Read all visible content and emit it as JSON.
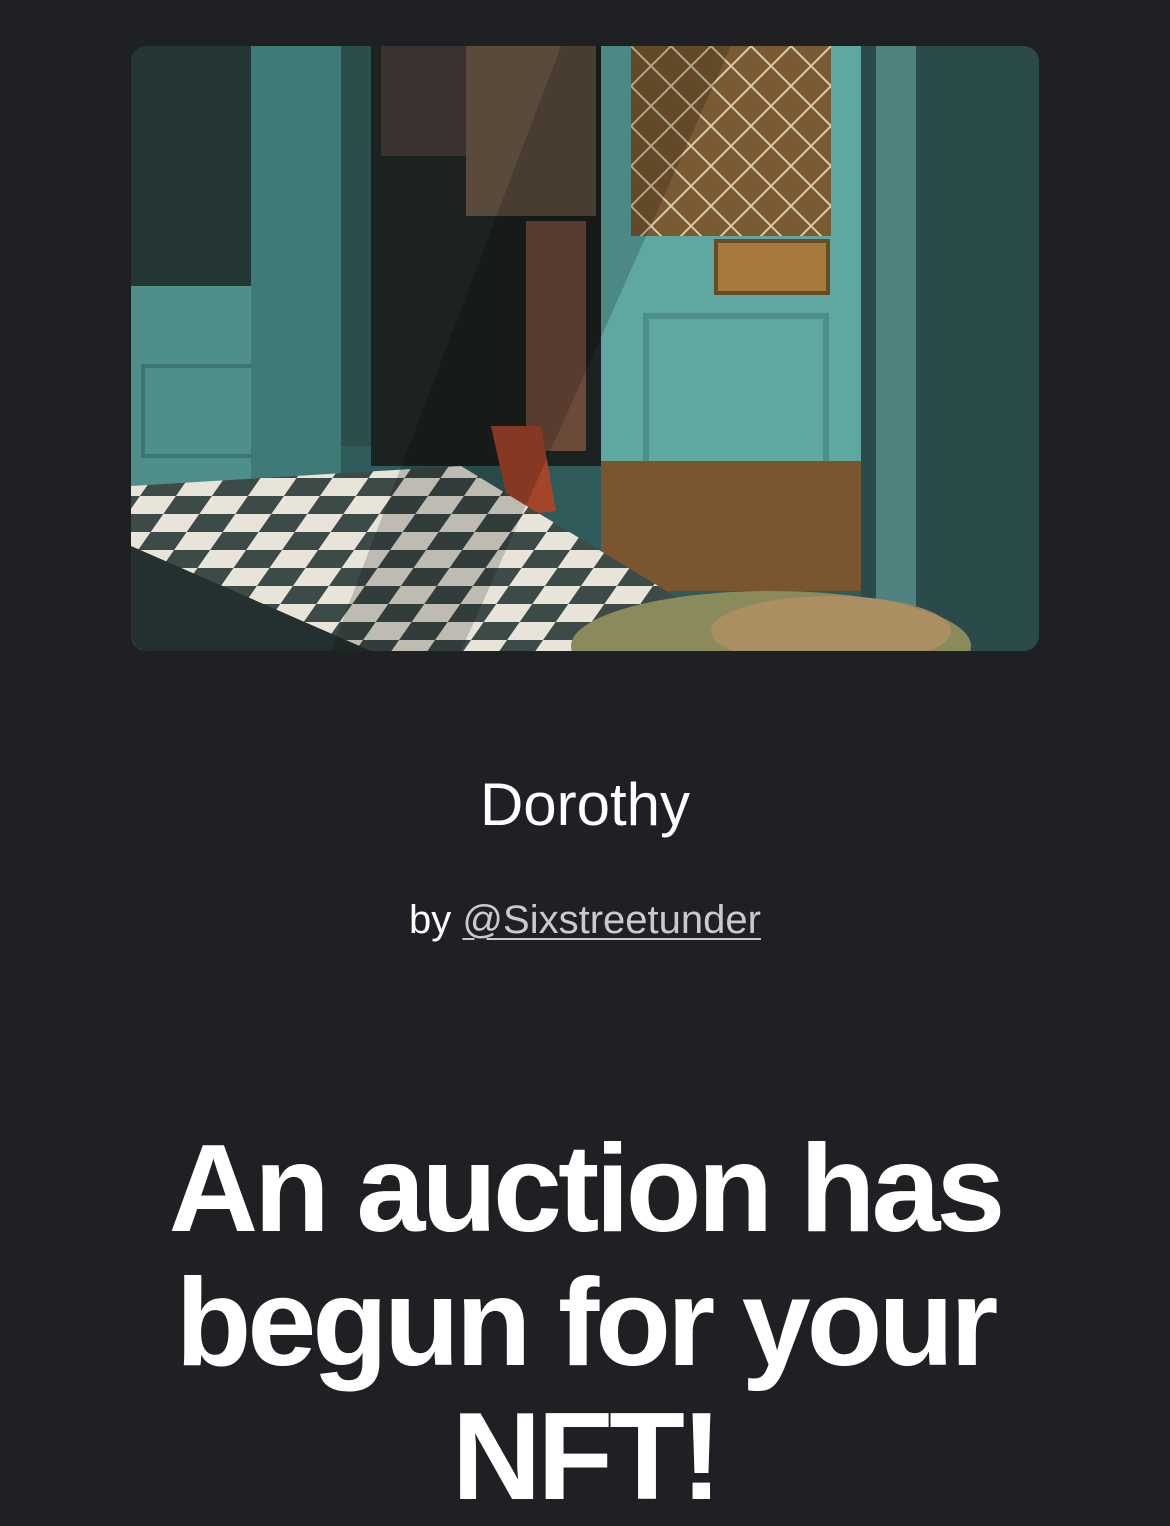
{
  "nft": {
    "image_alt": "Photograph of a person standing in a teal doorway with a checkered tile step",
    "title": "Dorothy",
    "by_prefix": "by",
    "creator_handle": "@Sixstreetunder"
  },
  "message": {
    "headline": "An auction has begun for your NFT!"
  },
  "colors": {
    "background": "#1f2024",
    "text": "#ffffff",
    "link": "#c9cacf"
  }
}
